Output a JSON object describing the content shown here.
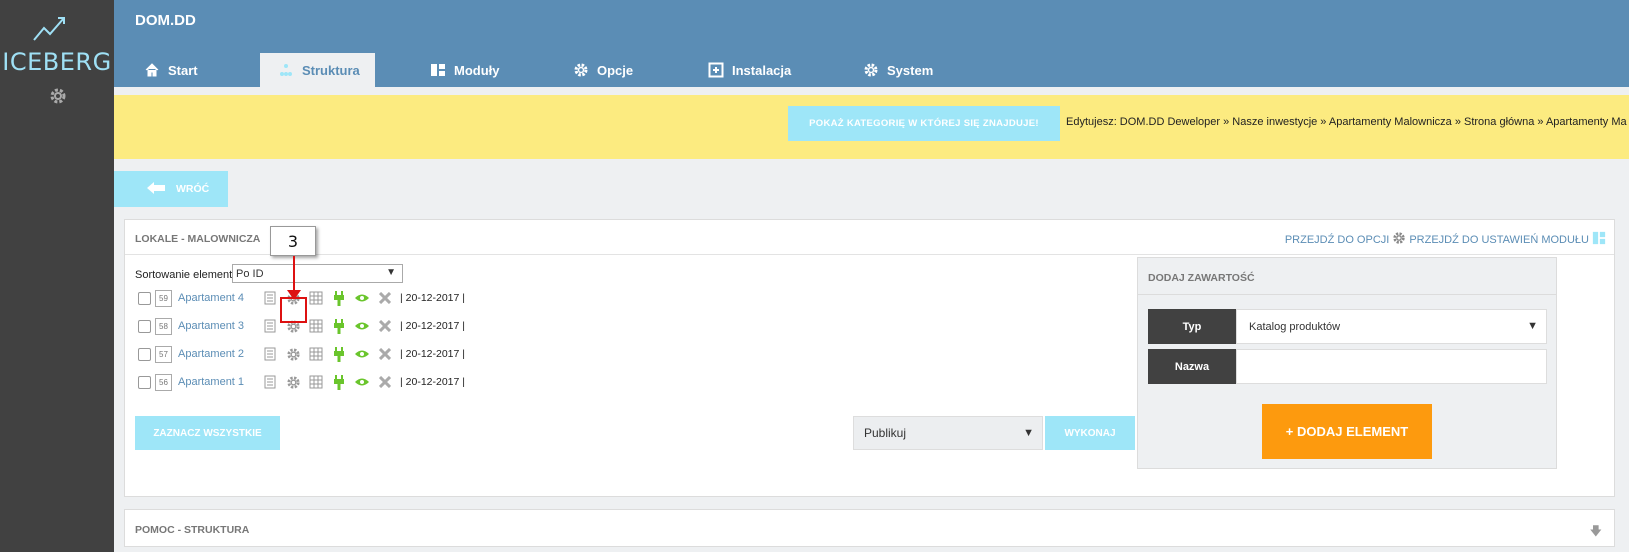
{
  "sidebar": {
    "logo_text": "ICEBERG",
    "settings_icon": "gear-icon"
  },
  "header": {
    "brand": "DOM.DD",
    "tabs": [
      {
        "label": "Start",
        "icon": "home-icon",
        "active": false
      },
      {
        "label": "Struktura",
        "icon": "structure-icon",
        "active": true
      },
      {
        "label": "Moduły",
        "icon": "modules-icon",
        "active": false
      },
      {
        "label": "Opcje",
        "icon": "gear-icon",
        "active": false
      },
      {
        "label": "Instalacja",
        "icon": "install-icon",
        "active": false
      },
      {
        "label": "System",
        "icon": "gear-icon",
        "active": false
      }
    ]
  },
  "notice": {
    "button_label": "POKAŻ KATEGORIĘ W KTÓREJ SIĘ ZNAJDUJE!",
    "breadcrumb": "Edytujesz: DOM.DD Deweloper » Nasze inwestycje » Apartamenty Malownicza » Strona główna » Apartamenty Ma"
  },
  "back_label": "WRÓĆ",
  "panel": {
    "title": "LOKALE - MALOWNICZA",
    "link_options": "PRZEJDŹ DO OPCJI",
    "link_module": "PRZEJDŹ DO USTAWIEŃ MODUŁU",
    "sort_label": "Sortowanie elementów:",
    "sort_value": "Po ID",
    "rows": [
      {
        "id": "59",
        "name": "Apartament 4",
        "date": "| 20-12-2017 |"
      },
      {
        "id": "58",
        "name": "Apartament 3",
        "date": "| 20-12-2017 |"
      },
      {
        "id": "57",
        "name": "Apartament 2",
        "date": "| 20-12-2017 |"
      },
      {
        "id": "56",
        "name": "Apartament 1",
        "date": "| 20-12-2017 |"
      }
    ],
    "select_all_label": "ZAZNACZ WSZYSTKIE",
    "action_value": "Publikuj",
    "execute_label": "WYKONAJ"
  },
  "add_content": {
    "title": "DODAJ ZAWARTOŚĆ",
    "type_label": "Typ",
    "type_value": "Katalog produktów",
    "name_label": "Nazwa",
    "name_value": "",
    "add_button": "+ DODAJ ELEMENT"
  },
  "help": {
    "title": "POMOC - STRUKTURA"
  },
  "annotation": {
    "number": "3"
  },
  "colors": {
    "header": "#5b8db5",
    "notice": "#fceb80",
    "accent_button": "#9ee6f8",
    "primary_action": "#fd9a0e",
    "sidebar": "#414141"
  }
}
